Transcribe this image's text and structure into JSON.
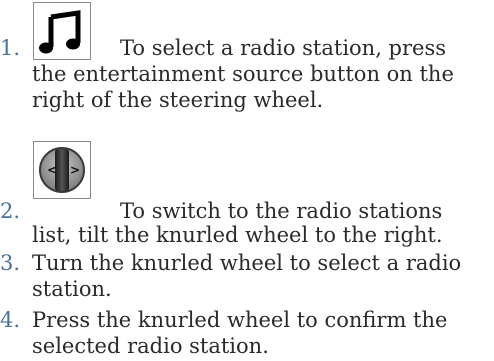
{
  "steps": [
    {
      "number": "1.",
      "icon": "music-note-icon",
      "line1": "To select a radio station, press",
      "line2": "the entertainment source button on the",
      "line3": "right of the steering wheel."
    },
    {
      "number": "2.",
      "icon": "knurled-wheel-left-right-icon",
      "line1": "To switch to the radio stations",
      "line2": "list, tilt the knurled wheel to the right."
    },
    {
      "number": "3.",
      "line1": "Turn the knurled wheel to select a radio",
      "line2": "station."
    },
    {
      "number": "4.",
      "line1": "Press the knurled wheel to confirm the",
      "line2": "selected radio station."
    }
  ],
  "colors": {
    "number": "#4a6f9a",
    "text": "#2a2a2a",
    "icon_border": "#8a8a8a"
  }
}
